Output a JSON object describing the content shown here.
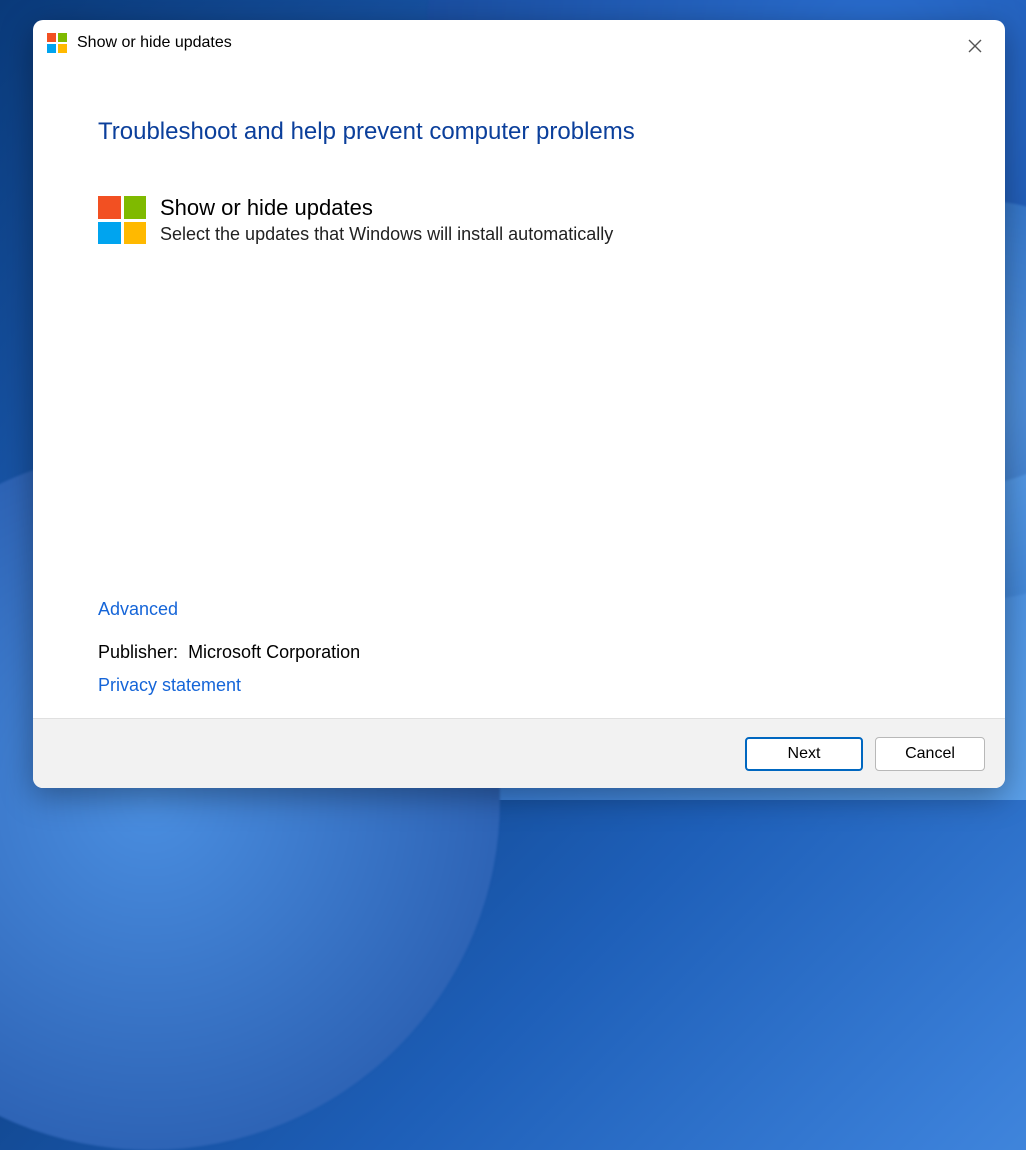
{
  "header": {
    "title": "Show or hide updates"
  },
  "main": {
    "heading": "Troubleshoot and help prevent computer problems",
    "item_title": "Show or hide updates",
    "item_desc": "Select the updates that Windows will install automatically"
  },
  "links": {
    "advanced": "Advanced",
    "publisher_label": "Publisher:",
    "publisher_value": "Microsoft Corporation",
    "privacy": "Privacy statement"
  },
  "footer": {
    "next_label": "Next",
    "cancel_label": "Cancel"
  }
}
